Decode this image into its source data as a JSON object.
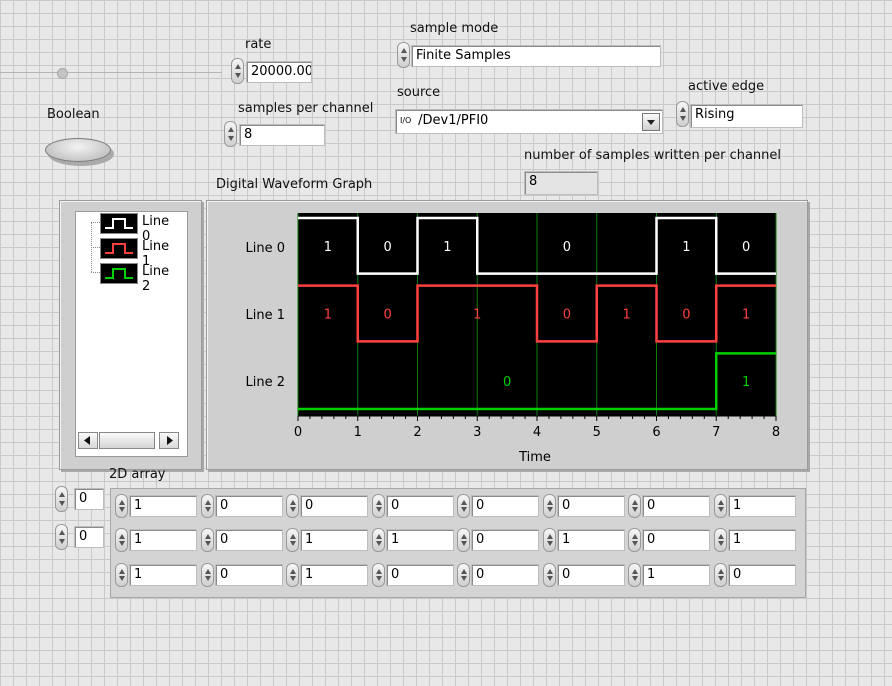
{
  "controls": {
    "rate": {
      "label": "rate",
      "value": "20000.00"
    },
    "samples_per_channel": {
      "label": "samples per channel",
      "value": "8"
    },
    "sample_mode": {
      "label": "sample mode",
      "value": "Finite Samples"
    },
    "source": {
      "label": "source",
      "value": "/Dev1/PFI0",
      "type_glyph": "I/O"
    },
    "active_edge": {
      "label": "active edge",
      "value": "Rising"
    },
    "boolean": {
      "label": "Boolean",
      "state": "off"
    },
    "samples_written": {
      "label": "number of samples written per channel",
      "value": "8"
    }
  },
  "graph": {
    "title": "Digital Waveform Graph",
    "xlabel": "Time",
    "x_ticks": [
      "0",
      "1",
      "2",
      "3",
      "4",
      "5",
      "6",
      "7",
      "8"
    ],
    "legend": [
      {
        "name": "Line 0",
        "color": "#ffffff"
      },
      {
        "name": "Line 1",
        "color": "#ff4040"
      },
      {
        "name": "Line 2",
        "color": "#00d000"
      }
    ]
  },
  "chart_data": {
    "type": "line",
    "title": "Digital Waveform Graph",
    "xlabel": "Time",
    "ylabel": "",
    "xlim": [
      0,
      8
    ],
    "grid": true,
    "step": true,
    "series": [
      {
        "name": "Line 0",
        "color": "#ffffff",
        "values": [
          1,
          0,
          1,
          0,
          0,
          0,
          1,
          0
        ],
        "labels": [
          {
            "x": 0.5,
            "text": "1"
          },
          {
            "x": 1.5,
            "text": "0"
          },
          {
            "x": 2.5,
            "text": "1"
          },
          {
            "x": 4.5,
            "text": "0"
          },
          {
            "x": 6.5,
            "text": "1"
          },
          {
            "x": 7.5,
            "text": "0"
          }
        ]
      },
      {
        "name": "Line 1",
        "color": "#ff4040",
        "values": [
          1,
          0,
          1,
          1,
          0,
          1,
          0,
          1
        ],
        "labels": [
          {
            "x": 0.5,
            "text": "1"
          },
          {
            "x": 1.5,
            "text": "0"
          },
          {
            "x": 3.0,
            "text": "1"
          },
          {
            "x": 4.5,
            "text": "0"
          },
          {
            "x": 5.5,
            "text": "1"
          },
          {
            "x": 6.5,
            "text": "0"
          },
          {
            "x": 7.5,
            "text": "1"
          }
        ]
      },
      {
        "name": "Line 2",
        "color": "#00d000",
        "values": [
          0,
          0,
          0,
          0,
          0,
          0,
          0,
          1
        ],
        "labels": [
          {
            "x": 3.5,
            "text": "0"
          },
          {
            "x": 7.5,
            "text": "1"
          }
        ]
      }
    ]
  },
  "array": {
    "label": "2D array",
    "index_values": [
      "0",
      "0"
    ],
    "rows": [
      [
        "1",
        "0",
        "0",
        "0",
        "0",
        "0",
        "0",
        "1"
      ],
      [
        "1",
        "0",
        "1",
        "1",
        "0",
        "1",
        "0",
        "1"
      ],
      [
        "1",
        "0",
        "1",
        "0",
        "0",
        "0",
        "1",
        "0"
      ]
    ]
  }
}
